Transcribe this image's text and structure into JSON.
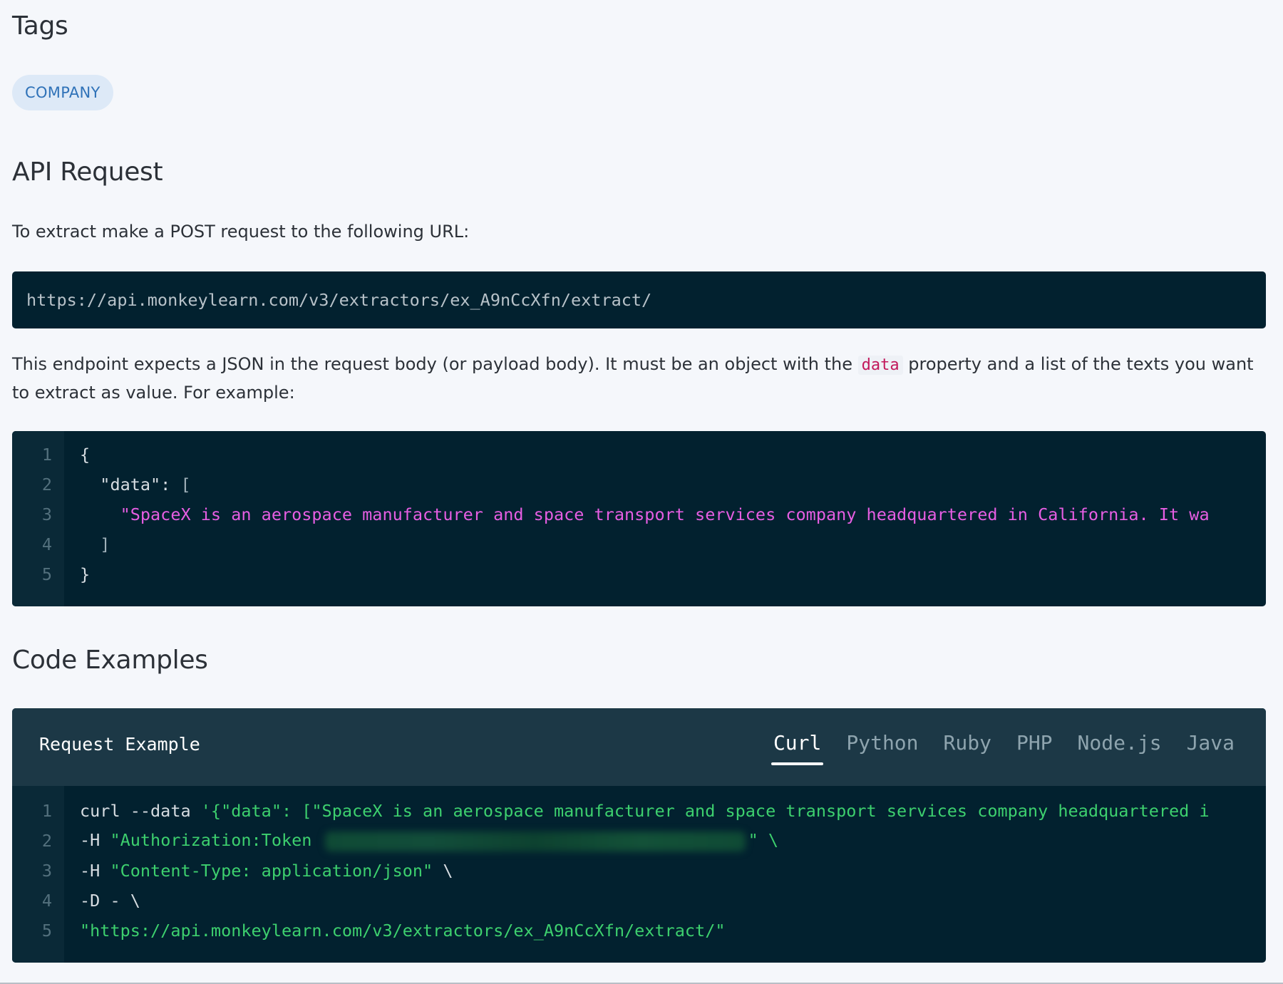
{
  "tags_section": {
    "heading": "Tags",
    "tags": [
      "COMPANY"
    ]
  },
  "api_section": {
    "heading": "API Request",
    "intro": "To extract make a POST request to the following URL:",
    "url": "https://api.monkeylearn.com/v3/extractors/ex_A9nCcXfn/extract/",
    "body_text_before": "This endpoint expects a JSON in the request body (or payload body). It must be an object with the ",
    "body_code": "data",
    "body_text_after": " property and a list of the texts you want to extract as value. For example:",
    "json_example": {
      "line_numbers": [
        "1",
        "2",
        "3",
        "4",
        "5"
      ],
      "line1": "{",
      "line2_key": "  \"data\": ",
      "line2_bracket": "[",
      "line3_string": "    \"SpaceX is an aerospace manufacturer and space transport services company headquartered in California. It wa",
      "line4": "  ]",
      "line5": "}"
    }
  },
  "code_section": {
    "heading": "Code Examples",
    "panel_title": "Request Example",
    "tabs": [
      "Curl",
      "Python",
      "Ruby",
      "PHP",
      "Node.js",
      "Java"
    ],
    "active_tab": "Curl",
    "line_numbers": [
      "1",
      "2",
      "3",
      "4",
      "5"
    ],
    "line1_cmd": "curl --data ",
    "line1_arg": "'{\"data\": [\"SpaceX is an aerospace manufacturer and space transport services company headquartered i",
    "line2_flag": "-H ",
    "line2_arg": "\"Authorization:Token ",
    "line2_end": "\" \\",
    "line3_flag": "-H ",
    "line3_arg": "\"Content-Type: application/json\"",
    "line3_end": " \\",
    "line4": "-D - \\",
    "line5": "\"https://api.monkeylearn.com/v3/extractors/ex_A9nCcXfn/extract/\""
  },
  "colors": {
    "code_bg": "#02212f",
    "tag_bg": "#dde9f7",
    "tag_text": "#2f72b8",
    "string_pink": "#e75ee3",
    "string_green": "#3dd06e"
  }
}
